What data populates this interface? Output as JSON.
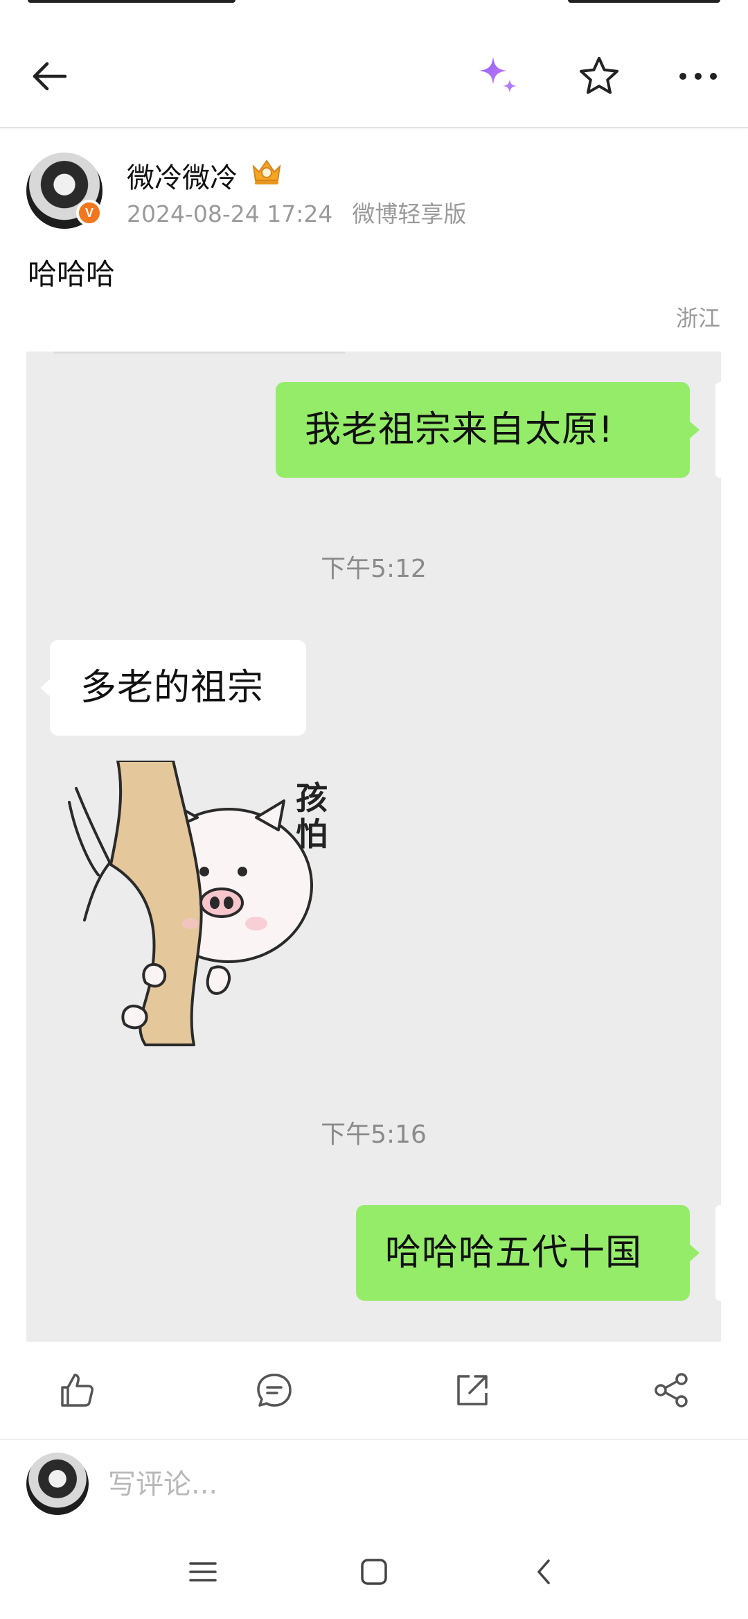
{
  "header": {
    "back_icon": "arrow-left-icon",
    "sparkle_icon": "sparkle-icon",
    "star_icon": "star-icon",
    "more_icon": "more-icon"
  },
  "post": {
    "author": "微冷微冷",
    "verified_badge": "V",
    "date": "2024-08-24 17:24",
    "source": "微博轻享版",
    "text": "哈哈哈",
    "location": "浙江"
  },
  "chat": {
    "messages": [
      {
        "side": "right",
        "text": "我老祖宗来自太原!"
      },
      {
        "timestamp": "下午5:12"
      },
      {
        "side": "left",
        "text": "多老的祖宗"
      },
      {
        "side": "left",
        "sticker_text": "孩怕"
      },
      {
        "timestamp": "下午5:16"
      },
      {
        "side": "right",
        "text": "哈哈哈五代十国"
      }
    ]
  },
  "actions": {
    "like_icon": "thumbs-up-icon",
    "comment_icon": "comment-icon",
    "repost_icon": "repost-icon",
    "share_icon": "share-icon"
  },
  "comment": {
    "placeholder": "写评论..."
  },
  "colors": {
    "bubble_sent": "#95ec69",
    "bubble_received": "#ffffff",
    "chat_bg": "#ececec",
    "verified": "#f0771e",
    "sparkle": "#9b6cf5"
  }
}
